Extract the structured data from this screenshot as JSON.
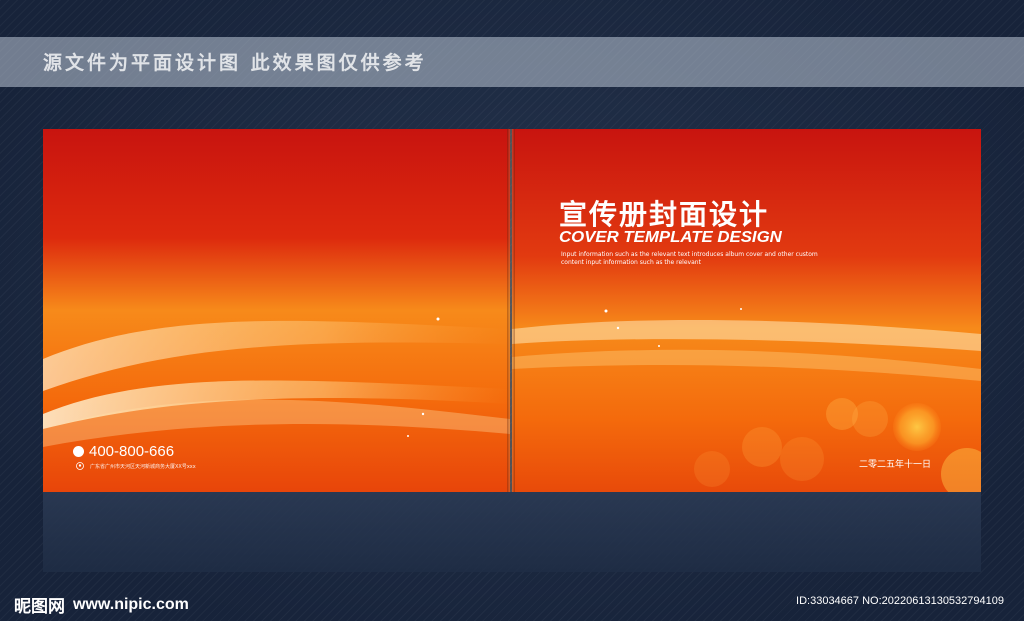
{
  "banner": {
    "text": "源文件为平面设计图 此效果图仅供参考"
  },
  "right_cover": {
    "title_cn": "宣传册封面设计",
    "title_en": "COVER TEMPLATE DESIGN",
    "description": "Input information such as the relevant text introduces album cover and other custom content input information such as the relevant",
    "date": "二零二五年十一日"
  },
  "left_cover": {
    "phone": "400-800-666",
    "address": "广东省广州市天河区天河新城商务大厦XX号xxx"
  },
  "watermark": {
    "logo_text": "昵图网",
    "url": "www.nipic.com",
    "id_text": "ID:33034667 NO:20220613130532794109"
  },
  "colors": {
    "cover_red": "#c8140f",
    "cover_orange": "#f46a0c",
    "background_navy": "#1c2a40"
  }
}
